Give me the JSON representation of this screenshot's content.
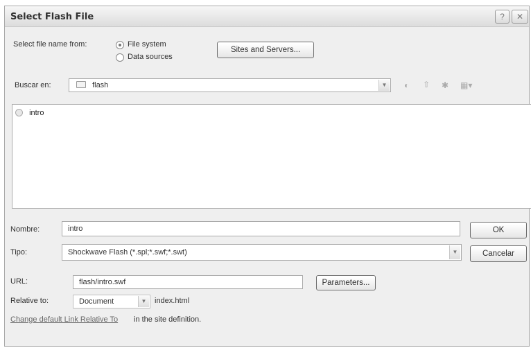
{
  "window": {
    "title": "Select Flash File",
    "help_glyph": "?"
  },
  "source": {
    "label": "Select file name from:",
    "options": [
      {
        "label": "File system",
        "selected": true
      },
      {
        "label": "Data sources",
        "selected": false
      }
    ],
    "sites_button": "Sites and Servers..."
  },
  "lookin": {
    "label": "Buscar en:",
    "folder": "flash"
  },
  "files": [
    {
      "name": "intro"
    }
  ],
  "filename": {
    "label": "Nombre:",
    "value": "intro",
    "ok_button": "OK"
  },
  "filetype": {
    "label": "Tipo:",
    "value": "Shockwave Flash (*.spl;*.swf;*.swt)",
    "cancel_button": "Cancelar"
  },
  "url": {
    "label": "URL:",
    "value": "flash/intro.swf",
    "parameters_button": "Parameters..."
  },
  "relative": {
    "label": "Relative to:",
    "value": "Document",
    "page": "index.html"
  },
  "footer": {
    "link": "Change default Link Relative To",
    "suffix": "in the site definition."
  }
}
